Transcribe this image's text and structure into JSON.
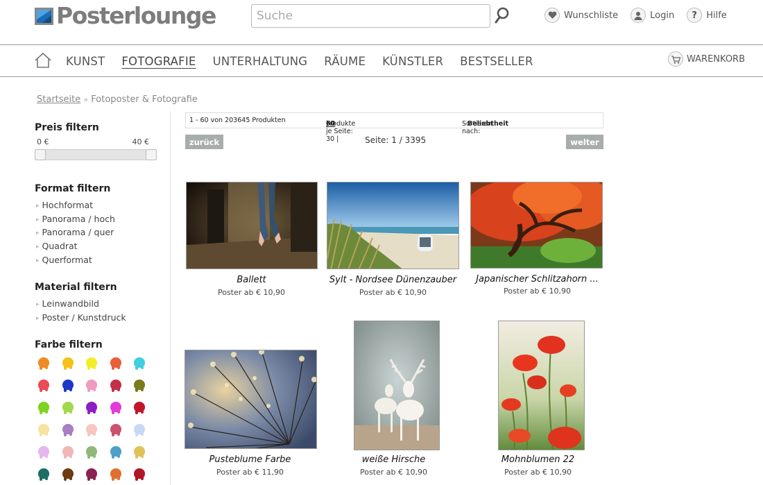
{
  "header": {
    "logo_text": "Posterlounge",
    "search_placeholder": "Suche",
    "links": [
      {
        "label": "Wunschliste",
        "icon": "heart-icon"
      },
      {
        "label": "Login",
        "icon": "user-icon"
      },
      {
        "label": "Hilfe",
        "icon": "help-icon"
      }
    ]
  },
  "nav": {
    "items": [
      "KUNST",
      "FOTOGRAFIE",
      "UNTERHALTUNG",
      "RÄUME",
      "KÜNSTLER",
      "BESTSELLER"
    ],
    "active": "FOTOGRAFIE",
    "cart_label": "WARENKORB"
  },
  "breadcrumb": {
    "home": "Startseite",
    "separator": "»",
    "current": "Fotoposter & Fotografie"
  },
  "filters": {
    "price": {
      "title": "Preis filtern",
      "min_label": "0 €",
      "max_label": "40 €"
    },
    "format": {
      "title": "Format filtern",
      "items": [
        "Hochformat",
        "Panorama / hoch",
        "Panorama / quer",
        "Quadrat",
        "Querformat"
      ]
    },
    "material": {
      "title": "Material filtern",
      "items": [
        "Leinwandbild",
        "Poster / Kunstdruck"
      ]
    },
    "color": {
      "title": "Farbe filtern",
      "swatches": [
        "#f08a22",
        "#f5c21a",
        "#f2ee2a",
        "#e8603a",
        "#3fd0e0",
        "#ec4a55",
        "#1b36c9",
        "#f09ac0",
        "#c2304a",
        "#7a7a1e",
        "#7ed321",
        "#a2d84b",
        "#8a1fc6",
        "#e43bd8",
        "#c0162b",
        "#f6e3a0",
        "#a97ec2",
        "#f6c7c0",
        "#c9526e",
        "#c9d8f4",
        "#e6b6ef",
        "#f2b6b8",
        "#8fb87a",
        "#4f9fc9",
        "#e0c25a",
        "#1d6e62",
        "#6e3a10",
        "#8b2252",
        "#e07030",
        "#b01426"
      ]
    }
  },
  "results": {
    "count_text": "1 - 60 von 203645 Produkten",
    "per_page_label": "Produkte je Seite: 30 |",
    "per_page_selected": "60",
    "per_page_sep": "|",
    "per_page_last": "90",
    "sort_label": "Sortieren nach:",
    "sort_value": "Beliebtheit",
    "prev_label": "zurück",
    "next_label": "welter",
    "page_text": "Seite: 1 / 3395"
  },
  "products": [
    {
      "title": "Ballett",
      "price": "Poster ab € 10,90"
    },
    {
      "title": "Sylt - Nordsee Dünenzauber",
      "price": "Poster ab € 10,90"
    },
    {
      "title": "Japanischer Schlitzahorn ...",
      "price": "Poster ab € 10,90"
    },
    {
      "title": "Pusteblume Farbe",
      "price": "Poster ab € 11,90"
    },
    {
      "title": "weiße Hirsche",
      "price": "Poster ab € 10,90"
    },
    {
      "title": "Mohnblumen 22",
      "price": "Poster ab € 10,90"
    }
  ]
}
